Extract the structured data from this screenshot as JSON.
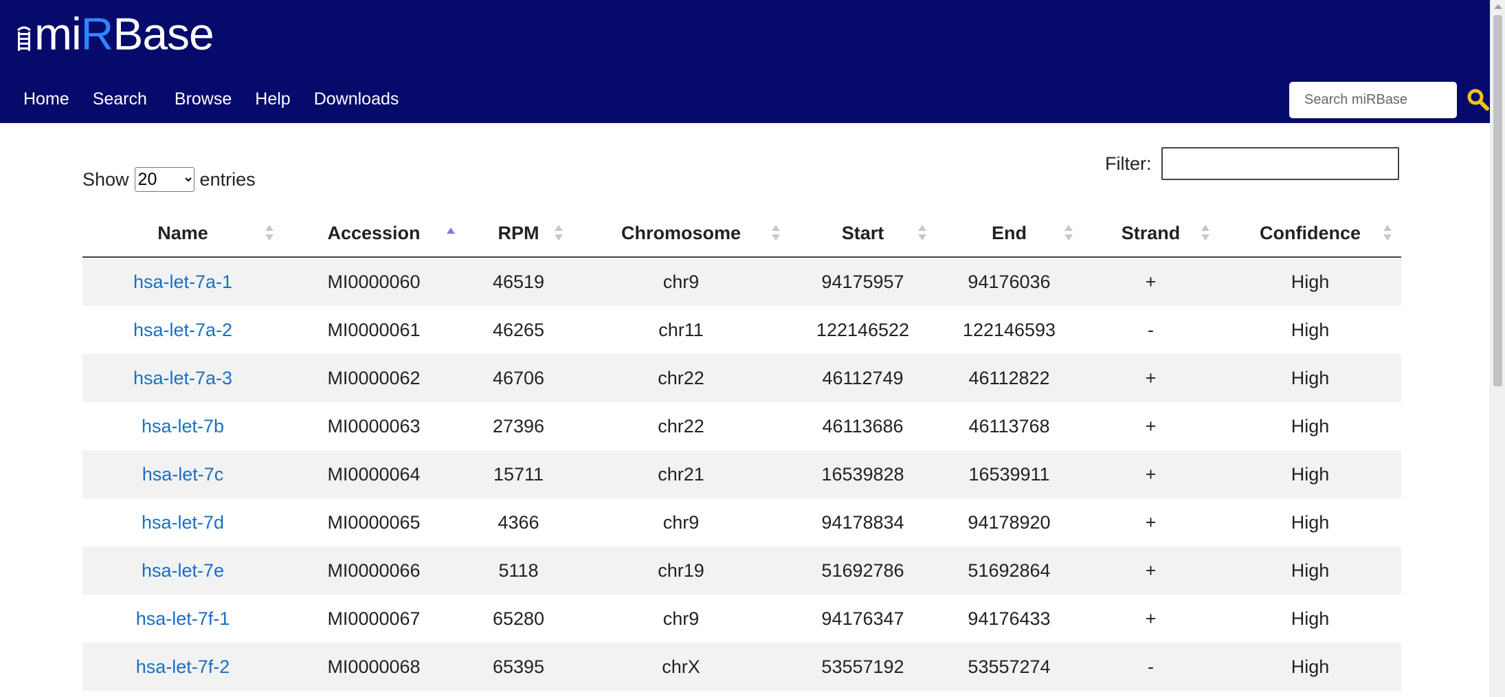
{
  "header": {
    "logo": {
      "prefix": "mi",
      "r": "R",
      "suffix": "Base"
    },
    "nav": [
      "Home",
      "Search",
      "Browse",
      "Help",
      "Downloads"
    ],
    "search_placeholder": "Search miRBase",
    "search_icon": "magnifier-icon",
    "bg_color": "#050a6b",
    "accent_color": "#f0c419"
  },
  "controls": {
    "show_label": "Show",
    "entries_label": "entries",
    "page_size": "20",
    "filter_label": "Filter:"
  },
  "table": {
    "columns": [
      "Name",
      "Accession",
      "RPM",
      "Chromosome",
      "Start",
      "End",
      "Strand",
      "Confidence"
    ],
    "sorted_column": "Accession",
    "sort_direction": "ascending",
    "rows": [
      [
        "hsa-let-7a-1",
        "MI0000060",
        "46519",
        "chr9",
        "94175957",
        "94176036",
        "+",
        "High"
      ],
      [
        "hsa-let-7a-2",
        "MI0000061",
        "46265",
        "chr11",
        "122146522",
        "122146593",
        "-",
        "High"
      ],
      [
        "hsa-let-7a-3",
        "MI0000062",
        "46706",
        "chr22",
        "46112749",
        "46112822",
        "+",
        "High"
      ],
      [
        "hsa-let-7b",
        "MI0000063",
        "27396",
        "chr22",
        "46113686",
        "46113768",
        "+",
        "High"
      ],
      [
        "hsa-let-7c",
        "MI0000064",
        "15711",
        "chr21",
        "16539828",
        "16539911",
        "+",
        "High"
      ],
      [
        "hsa-let-7d",
        "MI0000065",
        "4366",
        "chr9",
        "94178834",
        "94178920",
        "+",
        "High"
      ],
      [
        "hsa-let-7e",
        "MI0000066",
        "5118",
        "chr19",
        "51692786",
        "51692864",
        "+",
        "High"
      ],
      [
        "hsa-let-7f-1",
        "MI0000067",
        "65280",
        "chr9",
        "94176347",
        "94176433",
        "+",
        "High"
      ],
      [
        "hsa-let-7f-2",
        "MI0000068",
        "65395",
        "chrX",
        "53557192",
        "53557274",
        "-",
        "High"
      ]
    ]
  }
}
